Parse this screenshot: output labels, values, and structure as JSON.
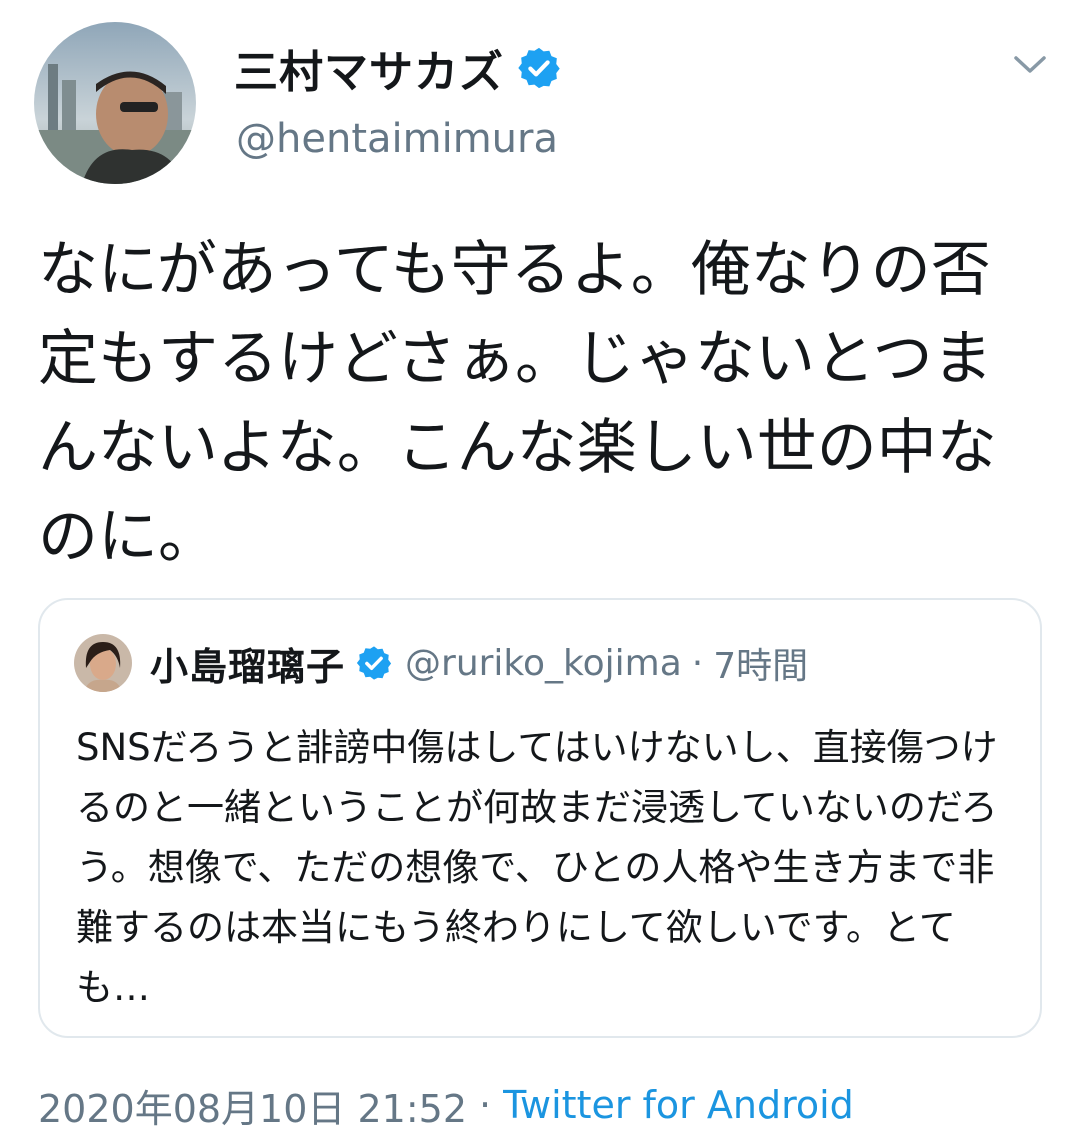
{
  "tweet": {
    "author": {
      "name": "三村マサカズ",
      "handle": "@hentaimimura",
      "verified_icon": "verified-badge-icon"
    },
    "menu_icon": "chevron-down-icon",
    "text": "なにがあっても守るよ。俺なりの否定もするけどさぁ。じゃないとつまんないよな。こんな楽しい世の中なのに。",
    "quoted_tweet": {
      "name": "小島瑠璃子",
      "handle": "@ruriko_kojima",
      "separator": "·",
      "time": "7時間",
      "text": "SNSだろうと誹謗中傷はしてはいけないし、直接傷つけるのと一緒ということが何故まだ浸透していないのだろう。想像で、ただの想像で、ひとの人格や生き方まで非難するのは本当にもう終わりにして欲しいです。とても…"
    },
    "timestamp": "2020年08月10日 21:52",
    "footer_separator": "·",
    "source": "Twitter for Android"
  },
  "colors": {
    "text_primary": "#14171a",
    "text_secondary": "#657786",
    "link": "#1b95e0",
    "verified": "#1da1f2",
    "border": "#e1e8ed"
  }
}
